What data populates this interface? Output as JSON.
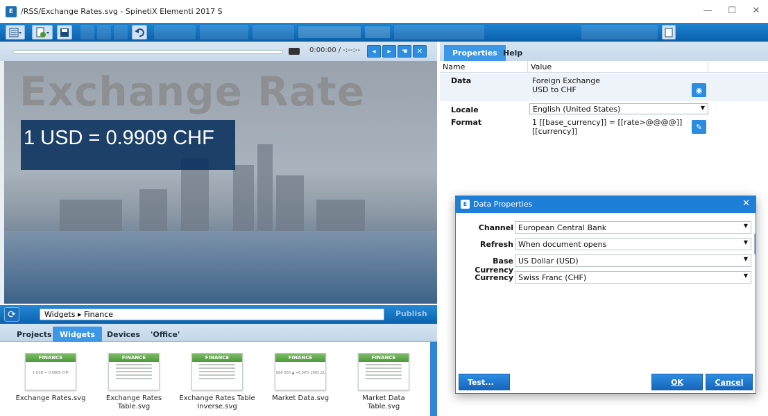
{
  "window": {
    "title": "/RSS/Exchange Rates.svg - SpinetiX Elementi 2017 S",
    "app_icon": "E",
    "controls": {
      "minimize": "—",
      "maximize": "☐",
      "close": "✕"
    }
  },
  "toolbar": {
    "icons": [
      "menu-icon",
      "new-document-icon",
      "save-icon",
      "undo-icon"
    ]
  },
  "player": {
    "time": "0:00:00 / -:--:--",
    "buttons": [
      "volume-icon",
      "play-icon",
      "pointer-icon",
      "close-icon"
    ]
  },
  "slide": {
    "title": "Exchange Rate",
    "rate_text": "1 USD = 0.9909 CHF"
  },
  "path_bar": {
    "path": "Widgets ▸ Finance",
    "publish_label": "Publish"
  },
  "widget_tabs": [
    "Projects",
    "Widgets",
    "Devices",
    "'Office'"
  ],
  "widgets": [
    {
      "thumb_title": "FINANCE",
      "thumb_text": "1 USD = 0.9909 CHF",
      "label": "Exchange Rates.svg"
    },
    {
      "thumb_title": "FINANCE",
      "thumb_text": "",
      "label": "Exchange Rates Table.svg"
    },
    {
      "thumb_title": "FINANCE",
      "thumb_text": "",
      "label": "Exchange Rates Table Inverse.svg"
    },
    {
      "thumb_title": "FINANCE",
      "thumb_text": "S&P 500 ▲ +0.56% 2065.21",
      "label": "Market Data.svg"
    },
    {
      "thumb_title": "FINANCE",
      "thumb_text": "",
      "label": "Market Data Table.svg"
    }
  ],
  "right_panel": {
    "tabs": [
      "Properties",
      "Help"
    ],
    "columns": {
      "name": "Name",
      "value": "Value"
    },
    "rows": {
      "data": {
        "label": "Data",
        "value_line1": "Foreign Exchange",
        "value_line2": "USD to CHF"
      },
      "locale": {
        "label": "Locale",
        "value": "English (United States)"
      },
      "format": {
        "label": "Format",
        "value_line1": "1 [[base_currency]] = [[rate>@@@@]]",
        "value_line2": "[[currency]]"
      }
    }
  },
  "dialog": {
    "title": "Data Properties",
    "fields": {
      "channel": {
        "label": "Channel",
        "value": "European Central Bank"
      },
      "refresh": {
        "label": "Refresh",
        "value": "When document opens"
      },
      "base_currency": {
        "label": "Base Currency",
        "value": "US Dollar (USD)"
      },
      "currency": {
        "label": "Currency",
        "value": "Swiss Franc (CHF)"
      }
    },
    "buttons": {
      "test": "Test...",
      "ok": "OK",
      "cancel": "Cancel"
    }
  },
  "colors": {
    "accent": "#1e7fd8",
    "toolbar": "#0a5ea8",
    "widget_header": "#4d9a39",
    "rate_box": "#052d5a"
  }
}
